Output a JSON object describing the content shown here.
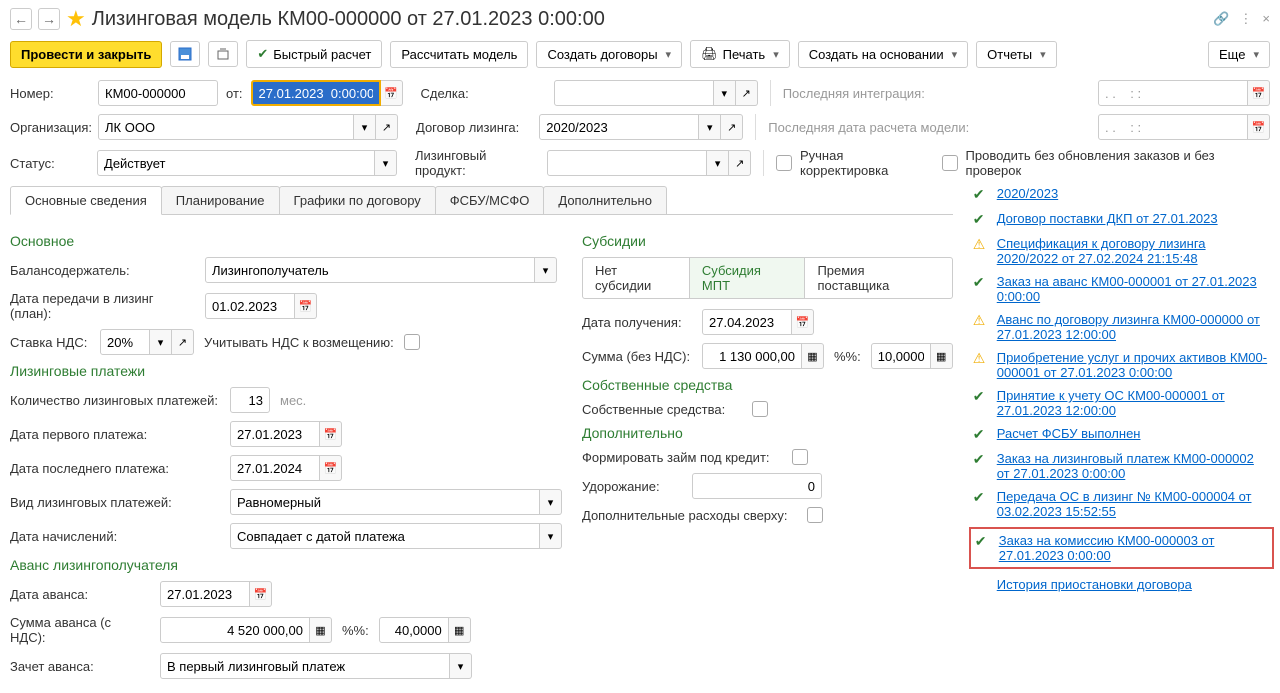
{
  "title": "Лизинговая модель КМ00-000000 от 27.01.2023 0:00:00",
  "toolbar": {
    "post_close": "Провести и закрыть",
    "quick_calc": "Быстрый расчет",
    "calc_model": "Рассчитать модель",
    "create_contracts": "Создать договоры",
    "print": "Печать",
    "create_based": "Создать на основании",
    "reports": "Отчеты",
    "more": "Еще"
  },
  "header": {
    "number_lbl": "Номер:",
    "number": "КМ00-000000",
    "from_lbl": "от:",
    "date": "27.01.2023  0:00:00",
    "deal_lbl": "Сделка:",
    "last_integration_lbl": "Последняя интеграция:",
    "last_integration": ". .    : :",
    "org_lbl": "Организация:",
    "org": "ЛК ООО",
    "lease_contract_lbl": "Договор лизинга:",
    "lease_contract": "2020/2023",
    "last_calc_lbl": "Последняя дата расчета модели:",
    "last_calc": ". .    : :",
    "status_lbl": "Статус:",
    "status": "Действует",
    "product_lbl": "Лизинговый продукт:",
    "manual_lbl": "Ручная корректировка",
    "no_update_lbl": "Проводить без обновления заказов и без проверок"
  },
  "tabs": {
    "t1": "Основные сведения",
    "t2": "Планирование",
    "t3": "Графики по договору",
    "t4": "ФСБУ/МСФО",
    "t5": "Дополнительно"
  },
  "main": {
    "s_basic": "Основное",
    "balance_holder_lbl": "Балансодержатель:",
    "balance_holder": "Лизингополучатель",
    "transfer_date_lbl": "Дата передачи в лизинг (план):",
    "transfer_date": "01.02.2023",
    "vat_rate_lbl": "Ставка НДС:",
    "vat_rate": "20%",
    "vat_credit_lbl": "Учитывать НДС к возмещению:",
    "s_payments": "Лизинговые платежи",
    "pay_count_lbl": "Количество лизинговых платежей:",
    "pay_count": "13",
    "pay_count_unit": "мес.",
    "first_pay_lbl": "Дата первого платежа:",
    "first_pay": "27.01.2023",
    "last_pay_lbl": "Дата последнего платежа:",
    "last_pay": "27.01.2024",
    "pay_type_lbl": "Вид лизинговых платежей:",
    "pay_type": "Равномерный",
    "accrual_date_lbl": "Дата начислений:",
    "accrual_date": "Совпадает с датой платежа",
    "s_advance": "Аванс лизингополучателя",
    "advance_date_lbl": "Дата аванса:",
    "advance_date": "27.01.2023",
    "advance_sum_lbl": "Сумма аванса (с НДС):",
    "advance_sum": "4 520 000,00",
    "pct_lbl": "%%:",
    "advance_pct": "40,0000",
    "advance_credit_lbl": "Зачет аванса:",
    "advance_credit": "В первый лизинговый платеж"
  },
  "mid": {
    "s_subsidy": "Субсидии",
    "seg_none": "Нет субсидии",
    "seg_mpt": "Субсидия МПТ",
    "seg_sup": "Премия поставщика",
    "receive_date_lbl": "Дата получения:",
    "receive_date": "27.04.2023",
    "sum_lbl": "Сумма (без НДС):",
    "sum": "1 130 000,00",
    "pct_lbl": "%%:",
    "pct": "10,0000",
    "s_own": "Собственные средства",
    "own_lbl": "Собственные средства:",
    "s_extra": "Дополнительно",
    "loan_lbl": "Формировать займ под кредит:",
    "markup_lbl": "Удорожание:",
    "markup": "0",
    "extra_cost_lbl": "Дополнительные расходы сверху:"
  },
  "links": {
    "l1": "2020/2023",
    "l2": " Договор поставки ДКП от 27.01.2023",
    "l3": "Спецификация к договору лизинга 2020/2022 от 27.02.2024 21:15:48",
    "l4": "Заказ на аванс КМ00-000001 от 27.01.2023 0:00:00",
    "l5": "Аванс по договору лизинга КМ00-000000 от 27.01.2023 12:00:00",
    "l6": "Приобретение услуг и прочих активов КМ00-000001 от 27.01.2023 0:00:00",
    "l7": "Принятие к учету ОС КМ00-000001 от 27.01.2023 12:00:00",
    "l8": "Расчет ФСБУ выполнен",
    "l9": "Заказ на лизинговый платеж КМ00-000002 от 27.01.2023 0:00:00",
    "l10": "Передача ОС в лизинг № КМ00-000004 от 03.02.2023 15:52:55",
    "l11": "Заказ на комиссию КМ00-000003 от 27.01.2023 0:00:00",
    "l12": "История приостановки договора"
  }
}
